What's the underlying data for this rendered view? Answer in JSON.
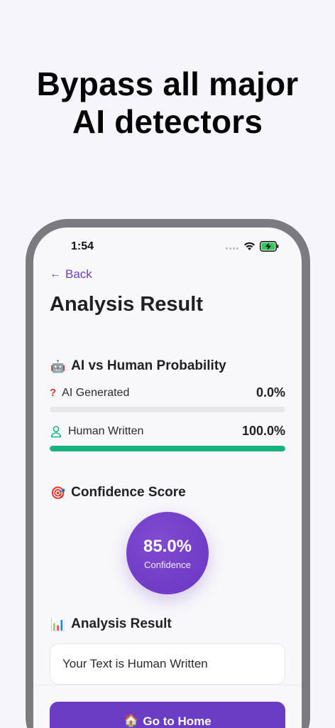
{
  "headline": {
    "line1": "Bypass all major",
    "line2": "AI detectors"
  },
  "status_bar": {
    "time": "1:54",
    "battery_charging": true
  },
  "nav": {
    "back_label": "Back"
  },
  "page": {
    "title": "Analysis Result"
  },
  "probability": {
    "title": "AI vs Human Probability",
    "icon": "robot-icon",
    "ai": {
      "label": "AI Generated",
      "value": "0.0%",
      "fraction": 0.0,
      "icon": "question-icon"
    },
    "human": {
      "label": "Human Written",
      "value": "100.0%",
      "fraction": 1.0,
      "icon": "person-icon"
    }
  },
  "confidence": {
    "title": "Confidence Score",
    "icon": "target-icon",
    "value": "85.0%",
    "caption": "Confidence"
  },
  "result": {
    "title": "Analysis Result",
    "icon": "bar-chart-icon",
    "text": "Your Text is Human Written"
  },
  "home_button": {
    "label": "Go to Home",
    "icon": "house-icon"
  },
  "colors": {
    "accent": "#6b3dc4",
    "success": "#16b47c",
    "danger": "#d9352f"
  }
}
